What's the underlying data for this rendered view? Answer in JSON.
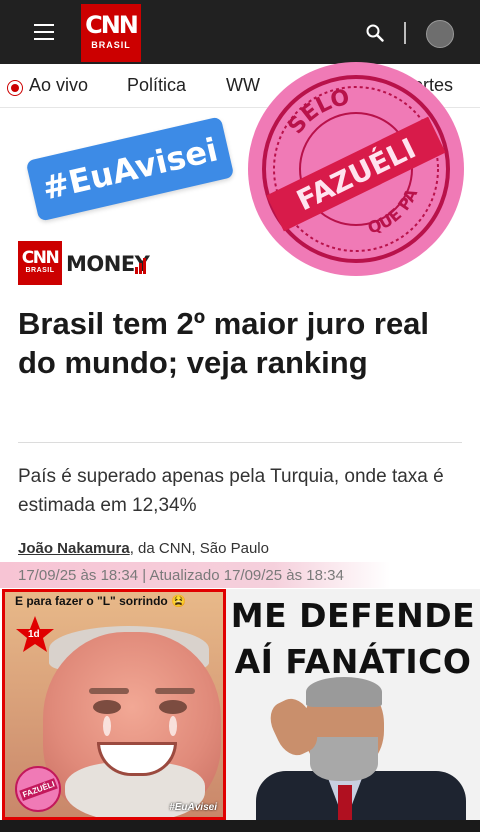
{
  "header": {
    "logo_cnn": "CNN",
    "logo_sub": "BRASIL"
  },
  "nav": {
    "live_label": "Ao vivo",
    "items": [
      "Política",
      "WW",
      "Esportes"
    ]
  },
  "stickers": {
    "hashtag": "#EuAvisei",
    "seal_top": "SELO",
    "seal_band": "FAZUÉLI",
    "seal_bottom": "QUE PASSA"
  },
  "brand": {
    "logo_cnn": "CNN",
    "logo_sub": "BRASIL",
    "section": "MONEY"
  },
  "article": {
    "headline": "Brasil tem 2º maior juro real do mundo; veja ranking",
    "subtitle": "País é superado apenas pela Turquia, onde taxa é estimada em 12,34%",
    "author": "João Nakamura",
    "byline_rest": ", da CNN, São Paulo",
    "dateline": "17/09/25 às 18:34 | Atualizado 17/09/25 às 18:34"
  },
  "memes": {
    "left_caption": "E para fazer o \"L\" sorrindo",
    "left_emoji": "😫",
    "left_badge": "1d",
    "left_seal": "FAZUÉLI",
    "left_tag": "#EuAvisei",
    "right_title_line1": "ME DEFENDE",
    "right_title_line2": "AÍ FANÁTICO"
  },
  "colors": {
    "cnn_red": "#cc0000",
    "topbar": "#212121",
    "hashtag_blue": "#3d8be6",
    "seal_pink": "#f07ab6",
    "seal_band_red": "#d81b4a"
  }
}
